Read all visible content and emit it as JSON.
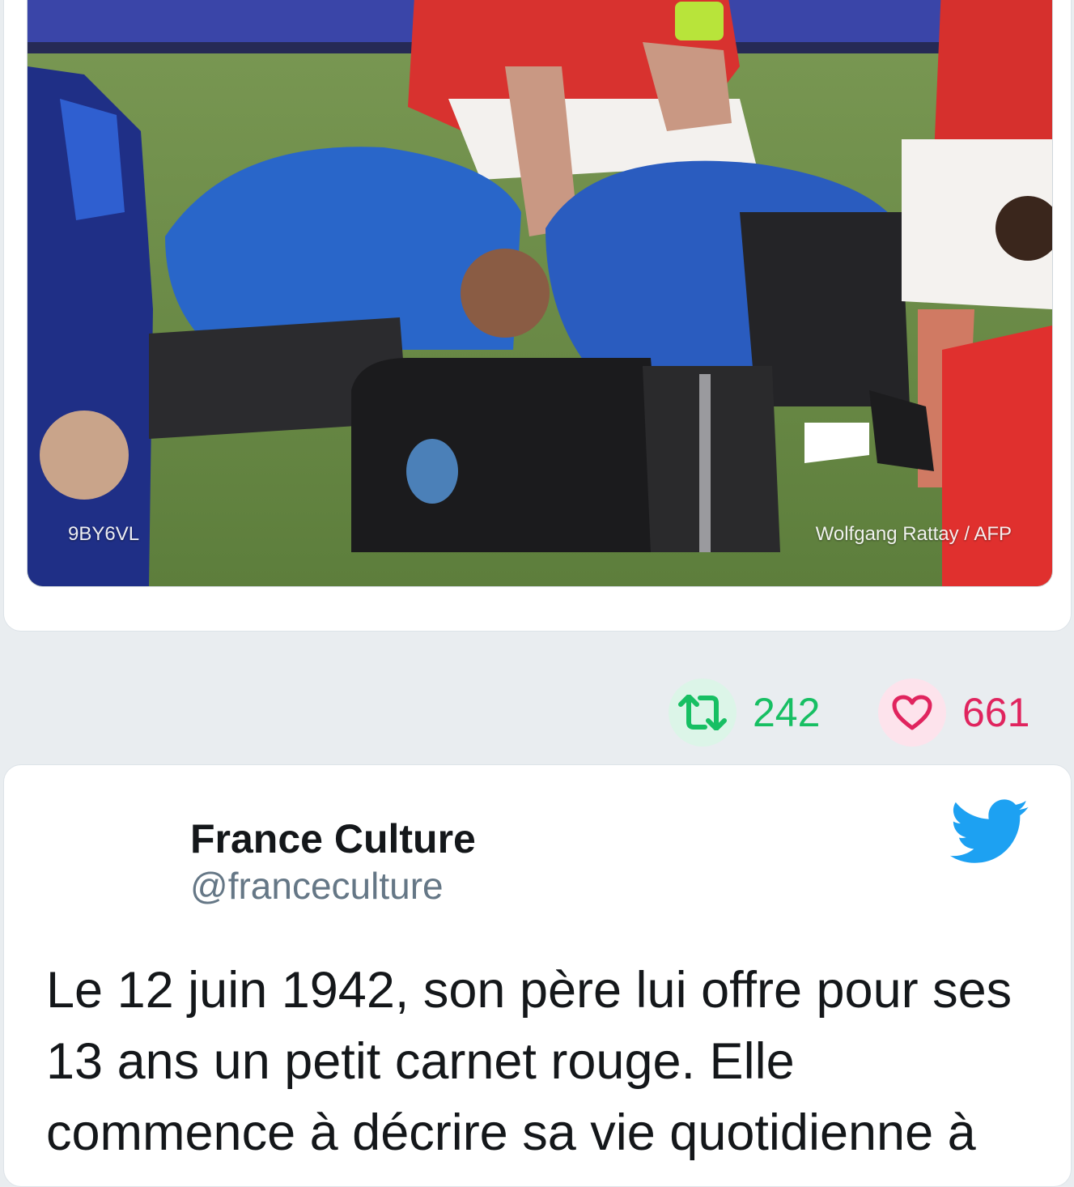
{
  "photo": {
    "watermark_id": "9BY6VL",
    "credit": "Wolfgang Rattay / AFP"
  },
  "actions": {
    "retweet_count": "242",
    "like_count": "661"
  },
  "tweet": {
    "author_name": "France Culture",
    "author_handle": "@franceculture",
    "text": "Le 12 juin 1942, son père lui offre pour ses 13 ans un petit carnet rouge. Elle commence à décrire sa vie quotidienne à"
  },
  "colors": {
    "retweet": "#17bf63",
    "like": "#e0245e",
    "twitter_blue": "#1da1f2"
  },
  "icons": [
    "retweet-icon",
    "heart-icon",
    "twitter-bird-icon"
  ]
}
